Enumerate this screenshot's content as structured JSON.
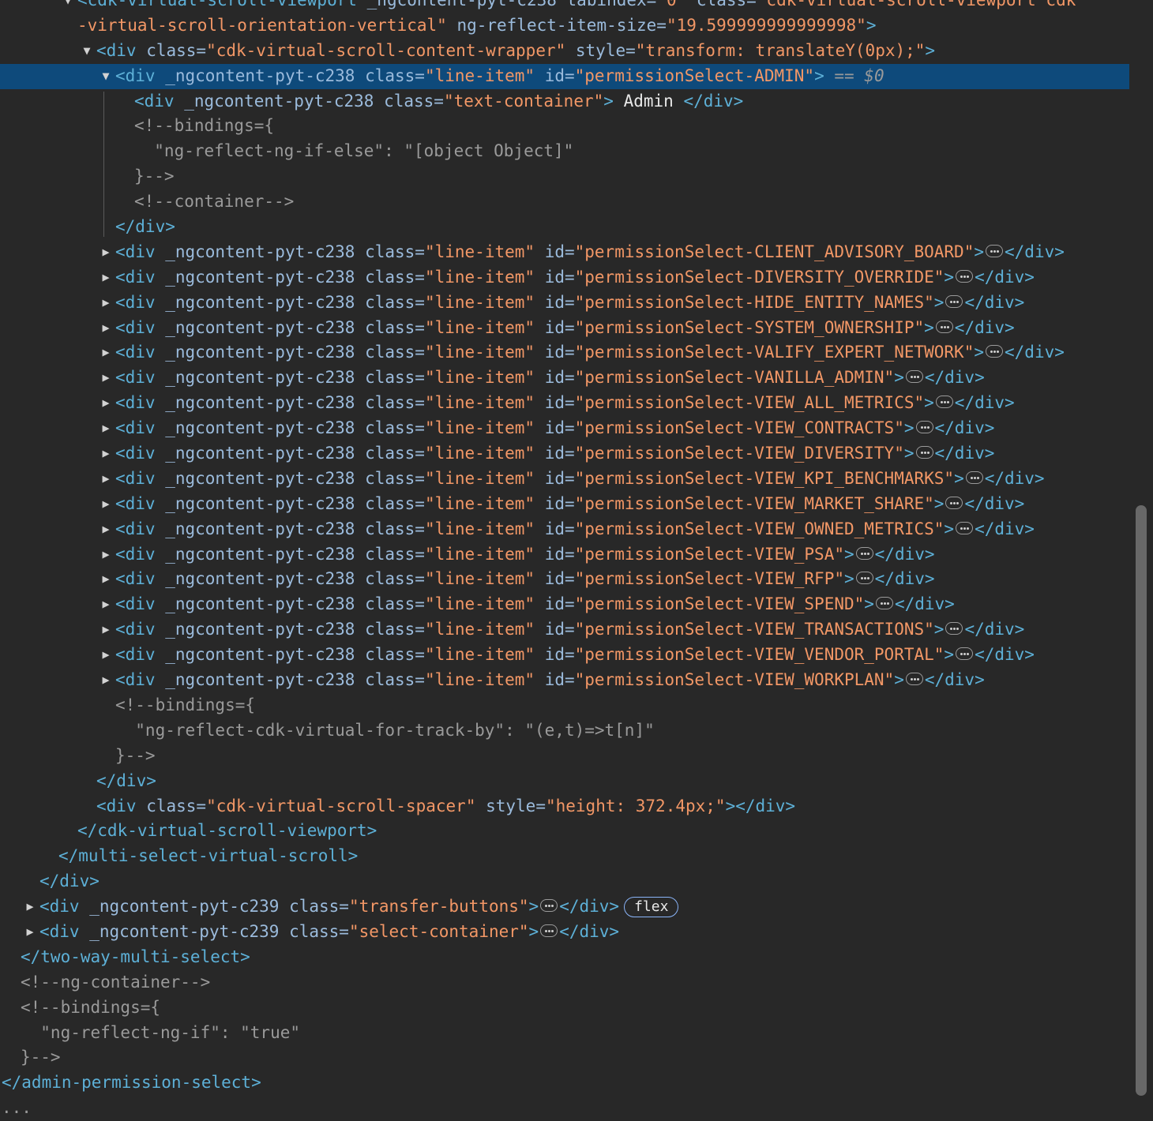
{
  "viewport": {
    "open": "<cdk-virtual-scroll-viewport",
    "ngcontent_attr": " _ngcontent-pyt-c238",
    "tabindex_attr": " tabindex=",
    "tabindex_val": "\"0\"",
    "class_attr": " class=",
    "class_val_1": "\"cdk-virtual-scroll-viewport cdk",
    "class_val_2": "-virtual-scroll-orientation-vertical\"",
    "reflect_attr": " ng-reflect-item-size=",
    "reflect_val": "\"19.599999999999998\"",
    "close": ">"
  },
  "wrapper": {
    "open": "<div",
    "class_attr": " class=",
    "class_val": "\"cdk-virtual-scroll-content-wrapper\"",
    "style_attr": " style=",
    "style_val": "\"transform: translateY(0px);\"",
    "close": ">"
  },
  "selected": {
    "open": "<div",
    "ng": " _ngcontent-pyt-c238",
    "class_attr": " class=",
    "class_val": "\"line-item\"",
    "id_attr": " id=",
    "id_val": "\"permissionSelect-ADMIN\"",
    "close": ">",
    "eq": " == ",
    "ref": "$0"
  },
  "text_container": {
    "open": "<div",
    "ng": " _ngcontent-pyt-c238",
    "class_attr": " class=",
    "class_val": "\"text-container\"",
    "gt": ">",
    "text": " Admin ",
    "close": "</div>"
  },
  "bindings_1": [
    "<!--bindings={",
    "  \"ng-reflect-ng-if-else\": \"[object Object]\"",
    "}-->"
  ],
  "container_comment": "<!--container-->",
  "close_div": "</div>",
  "line_item": {
    "open": "<div",
    "ng": " _ngcontent-pyt-c238",
    "class_attr": " class=",
    "class_val": "\"line-item\"",
    "id_attr": " id=",
    "close_tag": "</div>",
    "gt": ">"
  },
  "line_items": [
    "\"permissionSelect-CLIENT_ADVISORY_BOARD\"",
    "\"permissionSelect-DIVERSITY_OVERRIDE\"",
    "\"permissionSelect-HIDE_ENTITY_NAMES\"",
    "\"permissionSelect-SYSTEM_OWNERSHIP\"",
    "\"permissionSelect-VALIFY_EXPERT_NETWORK\"",
    "\"permissionSelect-VANILLA_ADMIN\"",
    "\"permissionSelect-VIEW_ALL_METRICS\"",
    "\"permissionSelect-VIEW_CONTRACTS\"",
    "\"permissionSelect-VIEW_DIVERSITY\"",
    "\"permissionSelect-VIEW_KPI_BENCHMARKS\"",
    "\"permissionSelect-VIEW_MARKET_SHARE\"",
    "\"permissionSelect-VIEW_OWNED_METRICS\"",
    "\"permissionSelect-VIEW_PSA\"",
    "\"permissionSelect-VIEW_RFP\"",
    "\"permissionSelect-VIEW_SPEND\"",
    "\"permissionSelect-VIEW_TRANSACTIONS\"",
    "\"permissionSelect-VIEW_VENDOR_PORTAL\"",
    "\"permissionSelect-VIEW_WORKPLAN\""
  ],
  "bindings_2": [
    "<!--bindings={",
    "  \"ng-reflect-cdk-virtual-for-track-by\": \"(e,t)=>t[n]\"",
    "}-->"
  ],
  "spacer": {
    "open": "<div",
    "class_attr": " class=",
    "class_val": "\"cdk-virtual-scroll-spacer\"",
    "style_attr": " style=",
    "style_val": "\"height: 372.4px;\"",
    "close": "></div>"
  },
  "close_viewport": "</cdk-virtual-scroll-viewport>",
  "close_multi": "</multi-select-virtual-scroll>",
  "transfer": {
    "open": "<div",
    "ng": " _ngcontent-pyt-c239",
    "class_attr": " class=",
    "class_val": "\"transfer-buttons\"",
    "gt": ">",
    "close_tag": "</div>",
    "badge": "flex"
  },
  "select_container": {
    "open": "<div",
    "ng": " _ngcontent-pyt-c239",
    "class_attr": " class=",
    "class_val": "\"select-container\"",
    "gt": ">",
    "close_tag": "</div>"
  },
  "close_two_way": "</two-way-multi-select>",
  "ng_container": "<!--ng-container-->",
  "bindings_3": [
    "<!--bindings={",
    "  \"ng-reflect-ng-if\": \"true\"",
    "}-->"
  ],
  "close_admin": "</admin-permission-select>",
  "trailing": "..."
}
